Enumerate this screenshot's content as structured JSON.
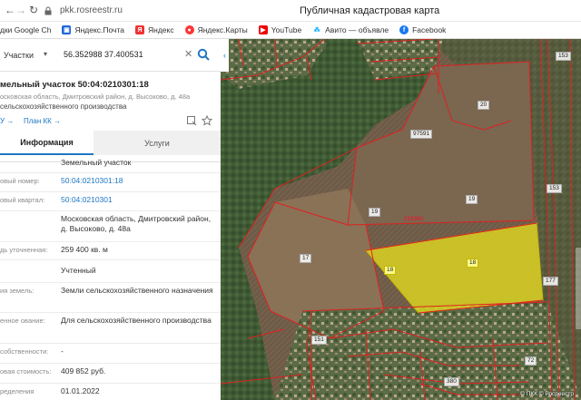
{
  "browser": {
    "url": "pkk.rosreestr.ru",
    "tab_title": "Публичная кадастровая карта"
  },
  "bookmarks": [
    {
      "label": "дки Google Ch",
      "icon": "google-icon"
    },
    {
      "label": "Яндекс.Почта",
      "icon": "yandex-mail-icon"
    },
    {
      "label": "Яндекс",
      "icon": "yandex-icon"
    },
    {
      "label": "Яндекс.Карты",
      "icon": "yandex-maps-icon"
    },
    {
      "label": "YouTube",
      "icon": "youtube-icon"
    },
    {
      "label": "Авито — объявле",
      "icon": "avito-icon"
    },
    {
      "label": "Facebook",
      "icon": "facebook-icon"
    }
  ],
  "search": {
    "type_label": "Участки",
    "query": "56.352988 37.400531"
  },
  "parcel": {
    "title": "мельный участок 50:04:0210301:18",
    "address": "осковская область, Дмитровский район, д. Высоково, д. 48а",
    "use": "сельскохозяйственного производства",
    "link_left": "У →",
    "link_plan": "План КК →"
  },
  "tabs": {
    "info": "Информация",
    "services": "Услуги"
  },
  "rows": [
    {
      "label": "",
      "value": "Земельный участок",
      "link": false
    },
    {
      "label": "овый номер:",
      "value": "50:04:0210301:18",
      "link": true
    },
    {
      "label": "овый квартал:",
      "value": "50:04:0210301",
      "link": true
    },
    {
      "label": "",
      "value": "Московская область, Дмитровский район, д. Высоково, д. 48а",
      "link": false
    },
    {
      "label": "дь уточненная:",
      "value": "259 400 кв. м",
      "link": false
    },
    {
      "label": "",
      "value": "Учтенный",
      "link": false
    },
    {
      "label": "ия земель:",
      "value": "Земли сельскохозяйственного назначения",
      "link": false
    },
    {
      "label": "енное ование:",
      "value": "Для сельскохозяйственного производства",
      "link": false
    },
    {
      "label": "собственности:",
      "value": "-",
      "link": false
    },
    {
      "label": "овая стоимость:",
      "value": "409 852 руб.",
      "link": false
    },
    {
      "label": "ределения",
      "value": "01.01.2022",
      "link": false
    }
  ],
  "map": {
    "parcel_labels": [
      "20",
      "97591",
      "19",
      "19",
      "17",
      "18",
      "18",
      "210301"
    ],
    "road_labels": [
      "153",
      "153",
      "177",
      "151",
      "72",
      "380"
    ],
    "copyright": "© ПКК © Росреестр",
    "selection_color": "#e8e01c",
    "boundary_color": "#e02020"
  }
}
